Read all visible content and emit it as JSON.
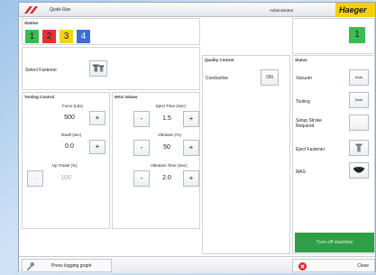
{
  "titlebar": {
    "title": "Quick Run",
    "user": "Administrator",
    "brand": "Haeger"
  },
  "station": {
    "label": "Station",
    "tiles": [
      {
        "num": "1",
        "color": "#3cba54"
      },
      {
        "num": "2",
        "color": "#e23232"
      },
      {
        "num": "3",
        "color": "#f4d21a"
      },
      {
        "num": "4",
        "color": "#3b6fd6"
      }
    ],
    "active": "1",
    "active_color": "#3cba54"
  },
  "fastener": {
    "label": "Select Fastener"
  },
  "tooling_control": {
    "label": "Tooling Control",
    "force_label": "Force (Lbs)",
    "force_value": "500",
    "dwell_label": "Dwell (sec)",
    "dwell_value": "0.0",
    "uptravel_label": "Up Travel (%)",
    "uptravel_value": "100"
  },
  "mas_values": {
    "label": "MAS Values",
    "eject_label": "Eject Time (Sec)",
    "eject_value": "1.5",
    "vibration_label": "Vibration (%)",
    "vibration_value": "50",
    "vibtime_label": "Vibration Time (Sec)",
    "vibtime_value": "2.0"
  },
  "quality": {
    "label": "Quality Control",
    "conductive": "Conductive",
    "on": "ON"
  },
  "status": {
    "label": "Status",
    "vacuum": "Vacuum",
    "vacuum_btn": "Auto",
    "tooling": "Tooling",
    "tooling_btn": "Bulk",
    "setup": "Setup Stroke Required",
    "eject": "Eject Fastener",
    "mas": "MAS"
  },
  "buttons": {
    "plus": "+",
    "minus": "-",
    "turn_off": "Turn off machine"
  },
  "footer": {
    "press_log": "Press logging graph",
    "close": "Close"
  }
}
